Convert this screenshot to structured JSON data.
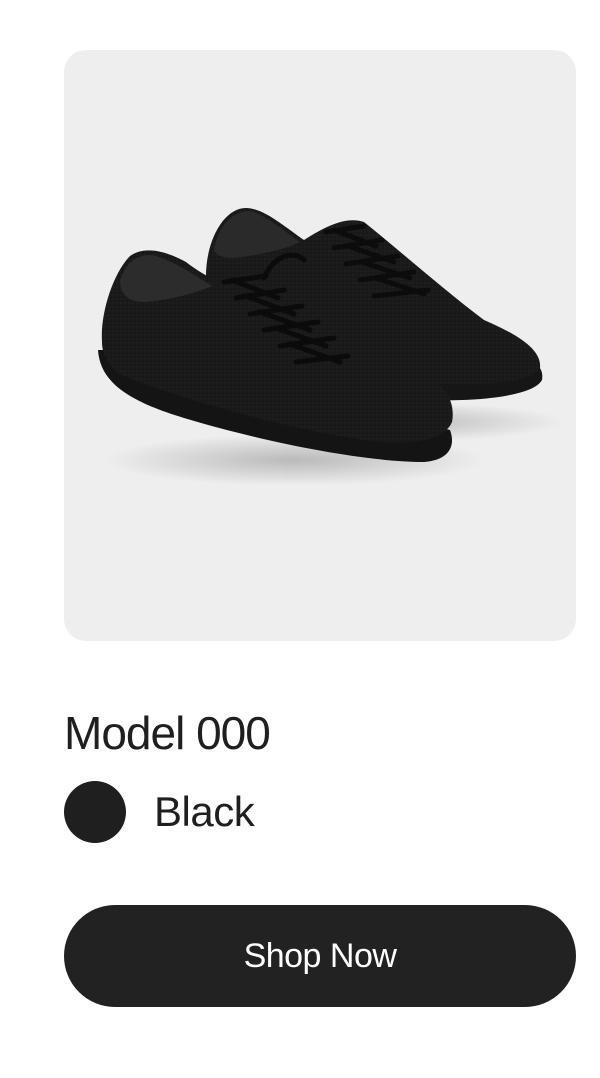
{
  "product": {
    "name": "Model 000",
    "image_alt": "Pair of black knit sneakers",
    "color": {
      "label": "Black",
      "hex": "#1f1f1f"
    },
    "cta_label": "Shop Now"
  },
  "theme": {
    "image_background": "#efeeee",
    "button_background": "#222222",
    "button_text": "#ffffff"
  }
}
